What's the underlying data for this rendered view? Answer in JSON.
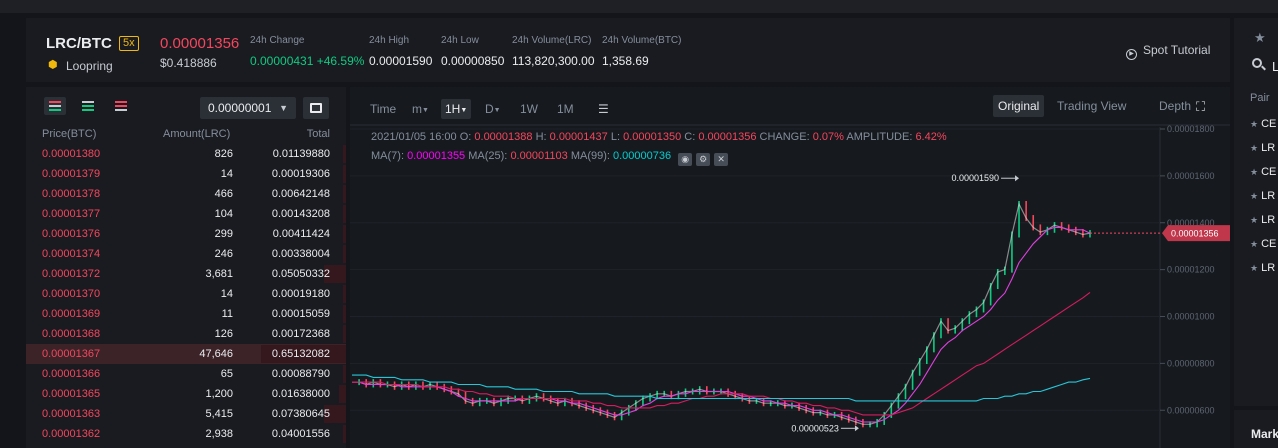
{
  "header": {
    "pair": "LRC/BTC",
    "leverage": "5x",
    "coin_name": "Loopring",
    "last_price": "0.00001356",
    "usd_price": "$0.418886",
    "stats": {
      "change_label": "24h Change",
      "change_value": "0.00000431 +46.59%",
      "high_label": "24h High",
      "high_value": "0.00001590",
      "low_label": "24h Low",
      "low_value": "0.00000850",
      "vol_base_label": "24h Volume(LRC)",
      "vol_base_value": "113,820,300.00",
      "vol_quote_label": "24h Volume(BTC)",
      "vol_quote_value": "1,358.69"
    },
    "spot_tutorial": "Spot Tutorial"
  },
  "orderbook": {
    "precision": "0.00000001",
    "col_price": "Price(BTC)",
    "col_amount": "Amount(LRC)",
    "col_total": "Total",
    "rows": [
      {
        "price": "0.00001380",
        "amount": "826",
        "total": "0.01139880",
        "depth": 0.04
      },
      {
        "price": "0.00001379",
        "amount": "14",
        "total": "0.00019306",
        "depth": 0.0
      },
      {
        "price": "0.00001378",
        "amount": "466",
        "total": "0.00642148",
        "depth": 0.02
      },
      {
        "price": "0.00001377",
        "amount": "104",
        "total": "0.00143208",
        "depth": 0.0
      },
      {
        "price": "0.00001376",
        "amount": "299",
        "total": "0.00411424",
        "depth": 0.01
      },
      {
        "price": "0.00001374",
        "amount": "246",
        "total": "0.00338004",
        "depth": 0.01
      },
      {
        "price": "0.00001372",
        "amount": "3,681",
        "total": "0.05050332",
        "depth": 0.26
      },
      {
        "price": "0.00001370",
        "amount": "14",
        "total": "0.00019180",
        "depth": 0.0
      },
      {
        "price": "0.00001369",
        "amount": "11",
        "total": "0.00015059",
        "depth": 0.0
      },
      {
        "price": "0.00001368",
        "amount": "126",
        "total": "0.00172368",
        "depth": 0.01
      },
      {
        "price": "0.00001367",
        "amount": "47,646",
        "total": "0.65132082",
        "depth": 1.0,
        "highlight": true
      },
      {
        "price": "0.00001366",
        "amount": "65",
        "total": "0.00088790",
        "depth": 0.0
      },
      {
        "price": "0.00001365",
        "amount": "1,200",
        "total": "0.01638000",
        "depth": 0.08
      },
      {
        "price": "0.00001363",
        "amount": "5,415",
        "total": "0.07380645",
        "depth": 0.26
      },
      {
        "price": "0.00001362",
        "amount": "2,938",
        "total": "0.04001556",
        "depth": 0.02
      }
    ]
  },
  "chart_toolbar": {
    "time": "Time",
    "minute": "m",
    "hour": "1H",
    "day": "D",
    "week": "1W",
    "month": "1M",
    "view_original": "Original",
    "view_trading": "Trading View",
    "view_depth": "Depth"
  },
  "chart_legend": {
    "date": "2021/01/05 16:00",
    "o_label": "O:",
    "o_value": "0.00001388",
    "h_label": "H:",
    "h_value": "0.00001437",
    "l_label": "L:",
    "l_value": "0.00001350",
    "c_label": "C:",
    "c_value": "0.00001356",
    "change_label": "CHANGE:",
    "change_value": "0.07%",
    "amp_label": "AMPLITUDE:",
    "amp_value": "6.42%",
    "ma7_label": "MA(7):",
    "ma7_value": "0.00001355",
    "ma25_label": "MA(25):",
    "ma25_value": "0.00001103",
    "ma99_label": "MA(99):",
    "ma99_value": "0.00000736"
  },
  "chart_data": {
    "type": "line",
    "title": "",
    "xlabel": "",
    "ylabel": "",
    "ylim": [
      5.2e-06,
      1.8e-05
    ],
    "y_ticks": [
      "0.00001800",
      "0.00001600",
      "0.00001400",
      "0.00001200",
      "0.00001000",
      "0.00000800",
      "0.00000600"
    ],
    "y_tick_values": [
      1.8e-05,
      1.6e-05,
      1.4e-05,
      1.2e-05,
      1e-05,
      8e-06,
      6e-06
    ],
    "current_price_label": "0.00001356",
    "current_price": 1.356e-05,
    "high_annotation": "0.00001590",
    "high_value": 1.59e-05,
    "low_annotation": "0.00000523",
    "low_value": 5.23e-06,
    "n_points": 105,
    "series": [
      {
        "name": "",
        "color": "#e8e8e8",
        "values": [
          7.2e-06,
          7.2e-06,
          7.1e-06,
          7.2e-06,
          7.1e-06,
          7.1e-06,
          7e-06,
          7.1e-06,
          7e-06,
          7.1e-06,
          7e-06,
          7.1e-06,
          7e-06,
          6.9e-06,
          6.8e-06,
          6.7e-06,
          6.4e-06,
          6.3e-06,
          6.4e-06,
          6.4e-06,
          6.3e-06,
          6.4e-06,
          6.5e-06,
          6.5e-06,
          6.4e-06,
          6.5e-06,
          6.6e-06,
          6.5e-06,
          6.4e-06,
          6.3e-06,
          6.4e-06,
          6.3e-06,
          6.2e-06,
          6.1e-06,
          6e-06,
          5.9e-06,
          5.8e-06,
          5.7e-06,
          5.9e-06,
          6.1e-06,
          6.3e-06,
          6.5e-06,
          6.6e-06,
          6.7e-06,
          6.7e-06,
          6.6e-06,
          6.7e-06,
          6.8e-06,
          6.8e-06,
          6.9e-06,
          6.8e-06,
          6.8e-06,
          6.8e-06,
          6.7e-06,
          6.6e-06,
          6.5e-06,
          6.4e-06,
          6.4e-06,
          6.3e-06,
          6.3e-06,
          6.3e-06,
          6.2e-06,
          6.2e-06,
          6.1e-06,
          6e-06,
          5.9e-06,
          5.9e-06,
          5.8e-06,
          5.8e-06,
          5.7e-06,
          5.6e-06,
          5.5e-06,
          5.4e-06,
          5.4e-06,
          5.5e-06,
          5.8e-06,
          6.2e-06,
          6.6e-06,
          7e-06,
          7.6e-06,
          8.1e-06,
          8.6e-06,
          9.2e-06,
          9.8e-06,
          9.4e-06,
          9.5e-06,
          9.8e-06,
          1.01e-05,
          1.03e-05,
          1.06e-05,
          1.13e-05,
          1.19e-05,
          1.2e-05,
          1.35e-05,
          1.48e-05,
          1.42e-05,
          1.38e-05,
          1.36e-05,
          1.37e-05,
          1.39e-05,
          1.38e-05,
          1.37e-05,
          1.36e-05,
          1.35e-05,
          1.356e-05
        ]
      },
      {
        "name": "MA(7)",
        "color": "#e040e0",
        "values": [
          7.2e-06,
          7.2e-06,
          7.1e-06,
          7.1e-06,
          7.1e-06,
          7.1e-06,
          7.1e-06,
          7e-06,
          7e-06,
          7e-06,
          7e-06,
          7e-06,
          7e-06,
          6.9e-06,
          6.8e-06,
          6.6e-06,
          6.5e-06,
          6.4e-06,
          6.4e-06,
          6.4e-06,
          6.4e-06,
          6.4e-06,
          6.4e-06,
          6.4e-06,
          6.5e-06,
          6.5e-06,
          6.5e-06,
          6.5e-06,
          6.5e-06,
          6.4e-06,
          6.4e-06,
          6.3e-06,
          6.3e-06,
          6.2e-06,
          6.1e-06,
          6e-06,
          5.9e-06,
          5.8e-06,
          5.8e-06,
          5.9e-06,
          6e-06,
          6.2e-06,
          6.3e-06,
          6.5e-06,
          6.6e-06,
          6.6e-06,
          6.7e-06,
          6.7e-06,
          6.8e-06,
          6.8e-06,
          6.8e-06,
          6.8e-06,
          6.8e-06,
          6.8e-06,
          6.7e-06,
          6.6e-06,
          6.6e-06,
          6.5e-06,
          6.4e-06,
          6.4e-06,
          6.3e-06,
          6.3e-06,
          6.2e-06,
          6.2e-06,
          6.1e-06,
          6e-06,
          6e-06,
          5.9e-06,
          5.8e-06,
          5.8e-06,
          5.7e-06,
          5.6e-06,
          5.5e-06,
          5.5e-06,
          5.5e-06,
          5.6e-06,
          5.8e-06,
          6e-06,
          6.3e-06,
          6.7e-06,
          7.1e-06,
          7.6e-06,
          8.1e-06,
          8.6e-06,
          8.9e-06,
          9.1e-06,
          9.4e-06,
          9.6e-06,
          9.8e-06,
          1e-05,
          1.03e-05,
          1.07e-05,
          1.1e-05,
          1.16e-05,
          1.23e-05,
          1.27e-05,
          1.31e-05,
          1.34e-05,
          1.37e-05,
          1.38e-05,
          1.38e-05,
          1.37e-05,
          1.37e-05,
          1.37e-05,
          1.355e-05
        ]
      },
      {
        "name": "MA(25)",
        "color": "#d81b60",
        "values": [
          7.2e-06,
          7.2e-06,
          7.2e-06,
          7.2e-06,
          7.2e-06,
          7.1e-06,
          7.1e-06,
          7.1e-06,
          7.1e-06,
          7.1e-06,
          7e-06,
          7e-06,
          7e-06,
          7e-06,
          6.9e-06,
          6.9e-06,
          6.8e-06,
          6.8e-06,
          6.7e-06,
          6.7e-06,
          6.6e-06,
          6.6e-06,
          6.6e-06,
          6.5e-06,
          6.5e-06,
          6.5e-06,
          6.5e-06,
          6.5e-06,
          6.5e-06,
          6.5e-06,
          6.5e-06,
          6.4e-06,
          6.4e-06,
          6.4e-06,
          6.3e-06,
          6.3e-06,
          6.2e-06,
          6.2e-06,
          6.1e-06,
          6.1e-06,
          6.1e-06,
          6.1e-06,
          6.1e-06,
          6.2e-06,
          6.2e-06,
          6.3e-06,
          6.3e-06,
          6.4e-06,
          6.5e-06,
          6.5e-06,
          6.6e-06,
          6.6e-06,
          6.7e-06,
          6.7e-06,
          6.7e-06,
          6.7e-06,
          6.6e-06,
          6.6e-06,
          6.6e-06,
          6.5e-06,
          6.5e-06,
          6.4e-06,
          6.4e-06,
          6.3e-06,
          6.3e-06,
          6.2e-06,
          6.2e-06,
          6.1e-06,
          6.1e-06,
          6e-06,
          6e-06,
          5.9e-06,
          5.8e-06,
          5.8e-06,
          5.8e-06,
          5.8e-06,
          5.8e-06,
          5.9e-06,
          6e-06,
          6.1e-06,
          6.3e-06,
          6.5e-06,
          6.7e-06,
          6.9e-06,
          7.1e-06,
          7.3e-06,
          7.5e-06,
          7.7e-06,
          7.9e-06,
          8e-06,
          8.2e-06,
          8.4e-06,
          8.6e-06,
          8.8e-06,
          9e-06,
          9.2e-06,
          9.4e-06,
          9.6e-06,
          9.8e-06,
          1e-05,
          1.02e-05,
          1.04e-05,
          1.06e-05,
          1.08e-05,
          1.103e-05
        ]
      },
      {
        "name": "MA(99)",
        "color": "#26c6da",
        "values": [
          7.5e-06,
          7.5e-06,
          7.5e-06,
          7.4e-06,
          7.4e-06,
          7.4e-06,
          7.4e-06,
          7.3e-06,
          7.3e-06,
          7.3e-06,
          7.3e-06,
          7.2e-06,
          7.2e-06,
          7.2e-06,
          7.2e-06,
          7.1e-06,
          7.1e-06,
          7.1e-06,
          7.1e-06,
          7e-06,
          7e-06,
          7e-06,
          7e-06,
          6.9e-06,
          6.9e-06,
          6.9e-06,
          6.9e-06,
          6.8e-06,
          6.8e-06,
          6.8e-06,
          6.8e-06,
          6.8e-06,
          6.7e-06,
          6.7e-06,
          6.7e-06,
          6.7e-06,
          6.7e-06,
          6.6e-06,
          6.6e-06,
          6.6e-06,
          6.6e-06,
          6.6e-06,
          6.6e-06,
          6.5e-06,
          6.5e-06,
          6.5e-06,
          6.5e-06,
          6.5e-06,
          6.5e-06,
          6.5e-06,
          6.5e-06,
          6.5e-06,
          6.5e-06,
          6.5e-06,
          6.5e-06,
          6.5e-06,
          6.5e-06,
          6.5e-06,
          6.5e-06,
          6.5e-06,
          6.5e-06,
          6.5e-06,
          6.5e-06,
          6.5e-06,
          6.5e-06,
          6.5e-06,
          6.5e-06,
          6.5e-06,
          6.5e-06,
          6.5e-06,
          6.5e-06,
          6.4e-06,
          6.4e-06,
          6.4e-06,
          6.4e-06,
          6.4e-06,
          6.4e-06,
          6.4e-06,
          6.4e-06,
          6.4e-06,
          6.4e-06,
          6.4e-06,
          6.4e-06,
          6.4e-06,
          6.4e-06,
          6.4e-06,
          6.4e-06,
          6.4e-06,
          6.4e-06,
          6.5e-06,
          6.5e-06,
          6.5e-06,
          6.6e-06,
          6.6e-06,
          6.7e-06,
          6.7e-06,
          6.8e-06,
          6.8e-06,
          6.9e-06,
          7e-06,
          7.1e-06,
          7.2e-06,
          7.2e-06,
          7.3e-06,
          7.36e-06
        ]
      }
    ],
    "grid": true
  },
  "markets": {
    "search_text": "L",
    "col_pair": "Pair",
    "items": [
      "CE",
      "LR",
      "CE",
      "LR",
      "LR",
      "CE",
      "LR"
    ],
    "bottom_label": "Mark"
  },
  "colors": {
    "red": "#f6465d",
    "green": "#0ecb81",
    "accent": "#f0b90b",
    "bg": "#14151a",
    "panel": "#1a1b20"
  }
}
